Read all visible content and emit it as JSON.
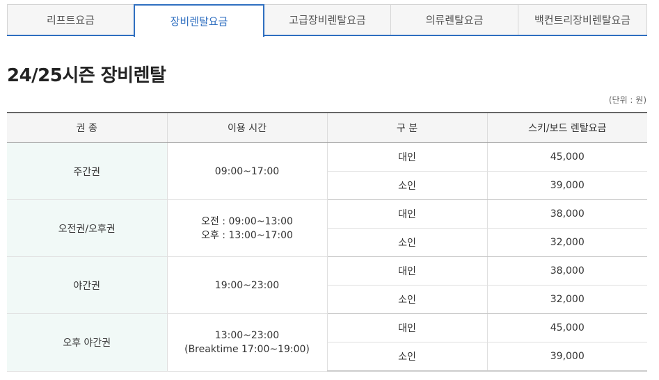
{
  "tabs": [
    {
      "label": "리프트요금"
    },
    {
      "label": "장비렌탈요금"
    },
    {
      "label": "고급장비렌탈요금"
    },
    {
      "label": "의류렌탈요금"
    },
    {
      "label": "백컨트리장비렌탈요금"
    }
  ],
  "active_tab": "장비렌탈요금",
  "colors": {
    "accent": "#2f6fc0",
    "ticket_cell_bg": "#f1f9f7"
  },
  "page_title": "24/25시즌 장비렌탈",
  "unit_note": "(단위 : 원)",
  "table": {
    "headers": [
      "권 종",
      "이용 시간",
      "구 분",
      "스키/보드 렌탈요금"
    ],
    "rows": [
      {
        "ticket": "주간권",
        "time": [
          "09:00~17:00"
        ],
        "prices": [
          {
            "category": "대인",
            "price": "45,000"
          },
          {
            "category": "소인",
            "price": "39,000"
          }
        ]
      },
      {
        "ticket": "오전권/오후권",
        "time": [
          "오전 : 09:00~13:00",
          "오후 : 13:00~17:00"
        ],
        "prices": [
          {
            "category": "대인",
            "price": "38,000"
          },
          {
            "category": "소인",
            "price": "32,000"
          }
        ]
      },
      {
        "ticket": "야간권",
        "time": [
          "19:00~23:00"
        ],
        "prices": [
          {
            "category": "대인",
            "price": "38,000"
          },
          {
            "category": "소인",
            "price": "32,000"
          }
        ]
      },
      {
        "ticket": "오후 야간권",
        "time": [
          "13:00~23:00",
          "(Breaktime 17:00~19:00)"
        ],
        "prices": [
          {
            "category": "대인",
            "price": "45,000"
          },
          {
            "category": "소인",
            "price": "39,000"
          }
        ]
      }
    ]
  }
}
